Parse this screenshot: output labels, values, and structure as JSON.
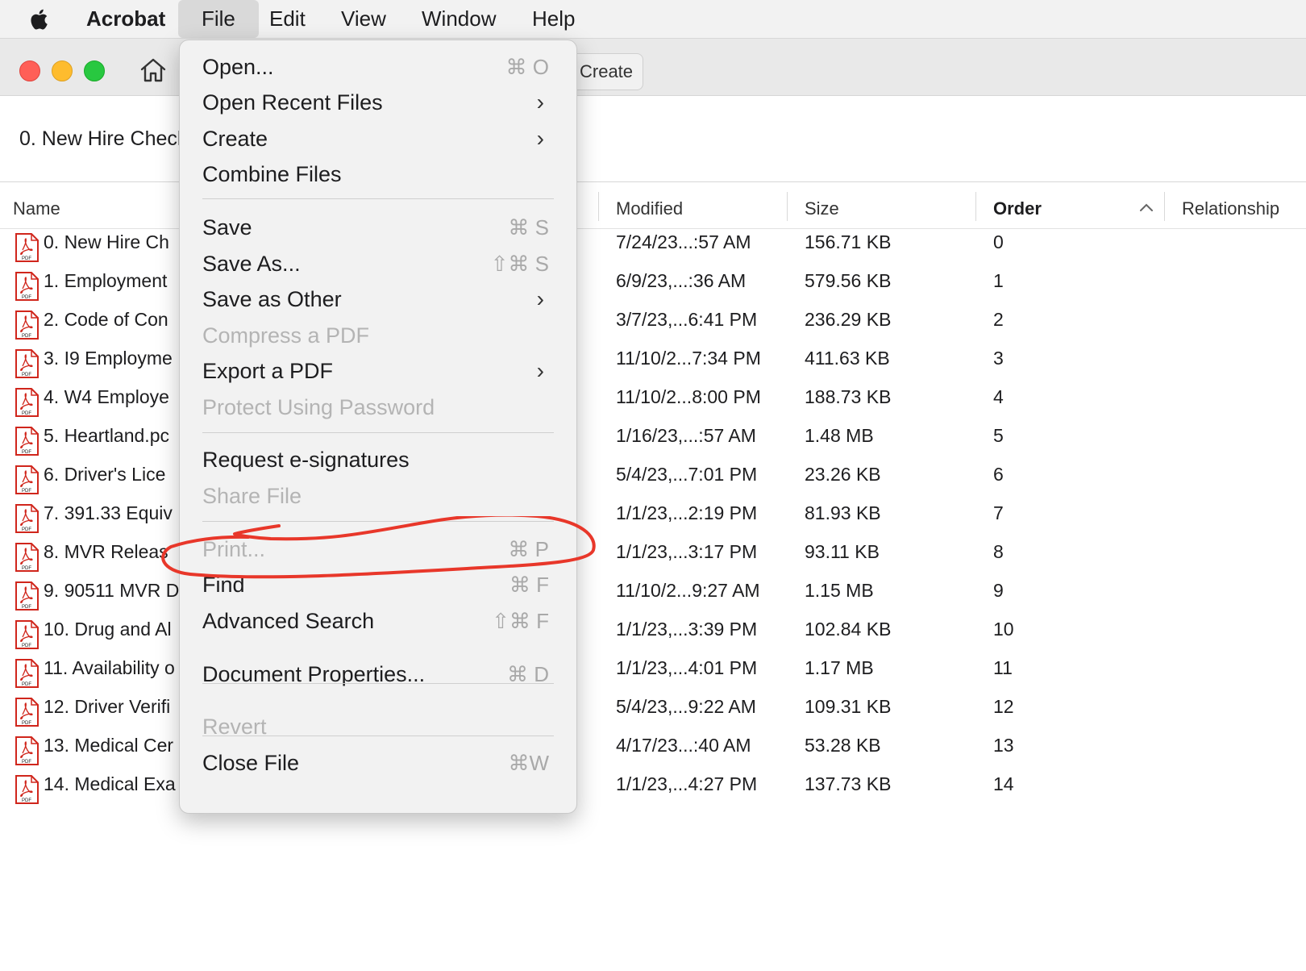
{
  "menubar": {
    "apple_icon": "apple-icon",
    "app_name": "Acrobat",
    "menus": [
      "File",
      "Edit",
      "View",
      "Window",
      "Help"
    ]
  },
  "toolbar": {
    "home_icon": "home-icon",
    "create_label": "Create"
  },
  "document_title": "0. New Hire Checl",
  "table": {
    "headers": {
      "name": "Name",
      "modified": "Modified",
      "size": "Size",
      "order": "Order",
      "relationship": "Relationship"
    },
    "rows": [
      {
        "name": "0. New Hire Ch",
        "modified": "7/24/23...:57 AM",
        "size": "156.71 KB",
        "order": "0"
      },
      {
        "name": "1. Employment",
        "modified": "6/9/23,...:36 AM",
        "size": "579.56 KB",
        "order": "1"
      },
      {
        "name": "2. Code of Con",
        "modified": "3/7/23,...6:41 PM",
        "size": "236.29 KB",
        "order": "2"
      },
      {
        "name": "3. I9 Employme",
        "modified": "11/10/2...7:34 PM",
        "size": "411.63 KB",
        "order": "3"
      },
      {
        "name": "4. W4 Employe",
        "modified": "11/10/2...8:00 PM",
        "size": "188.73 KB",
        "order": "4"
      },
      {
        "name": "5. Heartland.pc",
        "modified": "1/16/23,...:57 AM",
        "size": "1.48 MB",
        "order": "5"
      },
      {
        "name": "6. Driver's Lice",
        "modified": "5/4/23,...7:01 PM",
        "size": "23.26 KB",
        "order": "6"
      },
      {
        "name": "7. 391.33 Equiv",
        "modified": "1/1/23,...2:19 PM",
        "size": "81.93 KB",
        "order": "7"
      },
      {
        "name": "8. MVR Releas",
        "modified": "1/1/23,...3:17 PM",
        "size": "93.11 KB",
        "order": "8"
      },
      {
        "name": "9. 90511 MVR D",
        "modified": "11/10/2...9:27 AM",
        "size": "1.15 MB",
        "order": "9"
      },
      {
        "name": "10. Drug and Al",
        "modified": "1/1/23,...3:39 PM",
        "size": "102.84 KB",
        "order": "10"
      },
      {
        "name": "11. Availability o",
        "modified": "1/1/23,...4:01 PM",
        "size": "1.17 MB",
        "order": "11"
      },
      {
        "name": "12. Driver Verifi",
        "modified": "5/4/23,...9:22 AM",
        "size": "109.31 KB",
        "order": "12"
      },
      {
        "name": "13. Medical Cer",
        "modified": "4/17/23...:40 AM",
        "size": "53.28 KB",
        "order": "13"
      },
      {
        "name": "14. Medical Exa",
        "modified": "1/1/23,...4:27 PM",
        "size": "137.73 KB",
        "order": "14"
      }
    ]
  },
  "file_menu": {
    "items": [
      {
        "label": "Open...",
        "shortcut": "⌘ O"
      },
      {
        "label": "Open Recent Files",
        "submenu": true
      },
      {
        "label": "Create",
        "submenu": true
      },
      {
        "label": "Combine Files"
      },
      {
        "label": "Save",
        "shortcut": "⌘ S"
      },
      {
        "label": "Save As...",
        "shortcut": "⇧⌘ S"
      },
      {
        "label": "Save as Other",
        "submenu": true
      },
      {
        "label": "Compress a PDF",
        "disabled": true
      },
      {
        "label": "Export a PDF",
        "submenu": true
      },
      {
        "label": "Protect Using Password",
        "disabled": true
      },
      {
        "label": "Request e-signatures"
      },
      {
        "label": "Share File",
        "disabled": true
      },
      {
        "label": "Print...",
        "shortcut": "⌘ P",
        "disabled": true
      },
      {
        "label": "Find",
        "shortcut": "⌘ F"
      },
      {
        "label": "Advanced Search",
        "shortcut": "⇧⌘ F"
      },
      {
        "label": "Document Properties...",
        "shortcut": "⌘ D"
      },
      {
        "label": "Revert",
        "disabled": true
      },
      {
        "label": "Close File",
        "shortcut": "⌘W"
      }
    ],
    "chevron": "›"
  },
  "annotation_color": "#e8372a"
}
